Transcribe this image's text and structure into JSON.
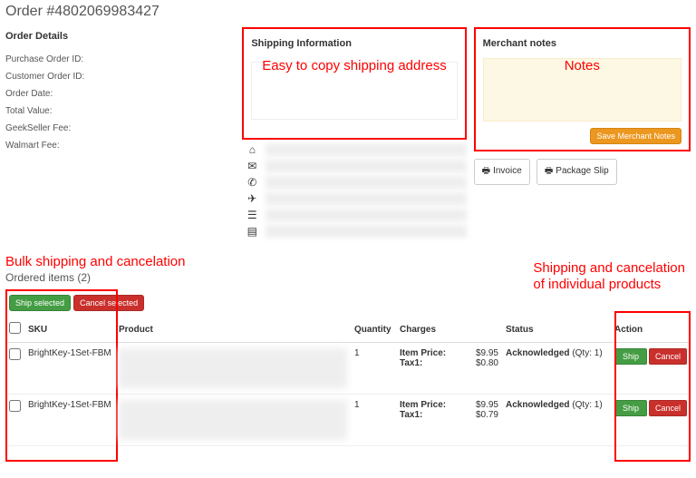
{
  "order_title": "Order #4802069983427",
  "details": {
    "heading": "Order Details",
    "rows": [
      {
        "label": "Purchase Order ID:"
      },
      {
        "label": "Customer Order ID:"
      },
      {
        "label": "Order Date:"
      },
      {
        "label": "Total Value:"
      },
      {
        "label": "GeekSeller Fee:"
      },
      {
        "label": "Walmart Fee:"
      }
    ]
  },
  "shipping": {
    "heading": "Shipping Information",
    "annotation": "Easy to copy shipping address",
    "icons": [
      "home-icon",
      "envelope-icon",
      "phone-icon",
      "plane-icon",
      "list-icon",
      "calendar-icon"
    ]
  },
  "notes": {
    "heading": "Merchant notes",
    "annotation": "Notes",
    "save_label": "Save Merchant Notes"
  },
  "docs": {
    "invoice_label": "Invoice",
    "slip_label": "Package Slip"
  },
  "bulk": {
    "annotation": "Bulk shipping and cancelation",
    "heading_prefix": "Ordered items",
    "count": "(2)",
    "ship_selected": "Ship selected",
    "cancel_selected": "Cancel selected"
  },
  "indiv_annotation_l1": "Shipping and cancelation",
  "indiv_annotation_l2": "of individual products",
  "table": {
    "headers": {
      "sku": "SKU",
      "product": "Product",
      "qty": "Quantity",
      "charges": "Charges",
      "status": "Status",
      "action": "Action"
    },
    "rows": [
      {
        "sku": "BrightKey-1Set-FBM",
        "qty": "1",
        "charge_label1": "Item Price:",
        "charge_val1": "$9.95",
        "charge_label2": "Tax1:",
        "charge_val2": "$0.80",
        "status_label": "Acknowledged",
        "status_qty": "(Qty: 1)",
        "ship": "Ship",
        "cancel": "Cancel"
      },
      {
        "sku": "BrightKey-1Set-FBM",
        "qty": "1",
        "charge_label1": "Item Price:",
        "charge_val1": "$9.95",
        "charge_label2": "Tax1:",
        "charge_val2": "$0.79",
        "status_label": "Acknowledged",
        "status_qty": "(Qty: 1)",
        "ship": "Ship",
        "cancel": "Cancel"
      }
    ]
  }
}
